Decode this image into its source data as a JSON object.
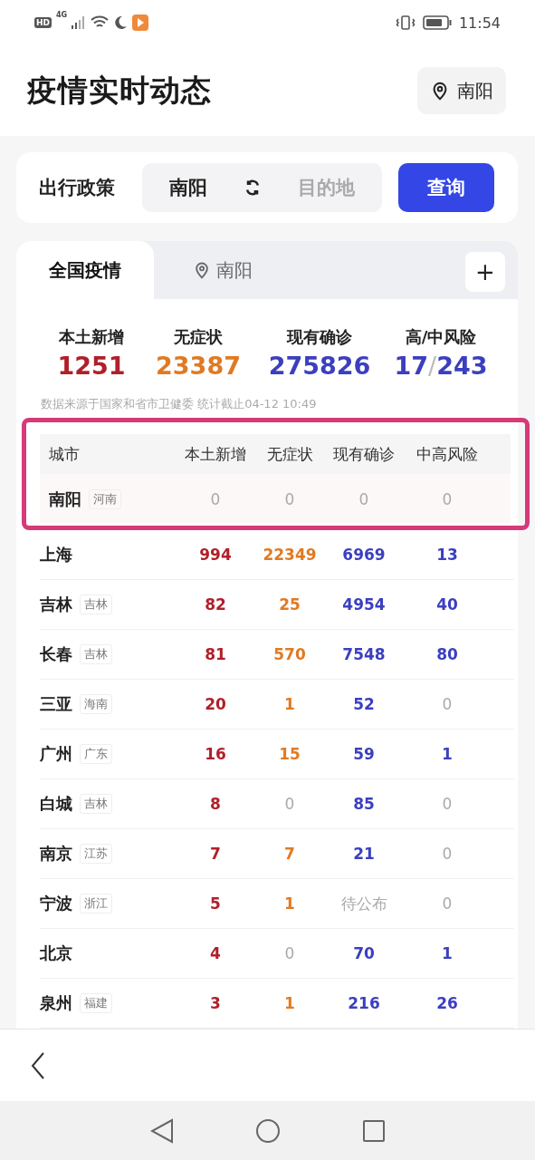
{
  "status_bar": {
    "left": "HD",
    "network": "4G",
    "time": "11:54"
  },
  "header": {
    "title": "疫情实时动态",
    "location": "南阳"
  },
  "policy": {
    "label": "出行政策",
    "from": "南阳",
    "to_placeholder": "目的地",
    "button": "查询"
  },
  "tabs": [
    {
      "label": "全国疫情",
      "selected": true,
      "kind": "plain"
    },
    {
      "label": "南阳",
      "selected": false,
      "kind": "location"
    }
  ],
  "add_button": "+",
  "stats": [
    {
      "label": "本土新增",
      "value": "1251",
      "color": "#b0202a"
    },
    {
      "label": "无症状",
      "value": "23387",
      "color": "#e07a22"
    },
    {
      "label": "现有确诊",
      "value": "275826",
      "color": "#3b3fbf"
    },
    {
      "label": "高/中风险",
      "value": "17",
      "separator": "/",
      "value2": "243",
      "color": "#3b3fbf"
    }
  ],
  "source_note": "数据来源于国家和省市卫健委 统计截止04-12 10:49",
  "table": {
    "columns": [
      "城市",
      "本土新增",
      "无症状",
      "现有确诊",
      "中高风险"
    ],
    "rows": [
      {
        "highlighted": true,
        "cells": [
          {
            "text": "南阳",
            "tag": "河南",
            "muted": false
          },
          {
            "text": "0",
            "muted": true
          },
          {
            "text": "0",
            "muted": true
          },
          {
            "text": "0",
            "muted": true
          },
          {
            "text": "0",
            "muted": true
          }
        ]
      },
      {
        "highlighted": false,
        "cells": [
          {
            "text": "上海",
            "muted": false
          },
          {
            "text": "994",
            "muted": false
          },
          {
            "text": "22349",
            "muted": false
          },
          {
            "text": "6969",
            "muted": false
          },
          {
            "text": "13",
            "muted": false
          }
        ]
      },
      {
        "highlighted": false,
        "cells": [
          {
            "text": "吉林",
            "tag": "吉林",
            "muted": false
          },
          {
            "text": "82",
            "muted": false
          },
          {
            "text": "25",
            "muted": false
          },
          {
            "text": "4954",
            "muted": false
          },
          {
            "text": "40",
            "muted": false
          }
        ]
      },
      {
        "highlighted": false,
        "cells": [
          {
            "text": "长春",
            "tag": "吉林",
            "muted": false
          },
          {
            "text": "81",
            "muted": false
          },
          {
            "text": "570",
            "muted": false
          },
          {
            "text": "7548",
            "muted": false
          },
          {
            "text": "80",
            "muted": false
          }
        ]
      },
      {
        "highlighted": false,
        "cells": [
          {
            "text": "三亚",
            "tag": "海南",
            "muted": false
          },
          {
            "text": "20",
            "muted": false
          },
          {
            "text": "1",
            "muted": false
          },
          {
            "text": "52",
            "muted": false
          },
          {
            "text": "0",
            "muted": true
          }
        ]
      },
      {
        "highlighted": false,
        "cells": [
          {
            "text": "广州",
            "tag": "广东",
            "muted": false
          },
          {
            "text": "16",
            "muted": false
          },
          {
            "text": "15",
            "muted": false
          },
          {
            "text": "59",
            "muted": false
          },
          {
            "text": "1",
            "muted": false
          }
        ]
      },
      {
        "highlighted": false,
        "cells": [
          {
            "text": "白城",
            "tag": "吉林",
            "muted": false
          },
          {
            "text": "8",
            "muted": false
          },
          {
            "text": "0",
            "muted": true
          },
          {
            "text": "85",
            "muted": false
          },
          {
            "text": "0",
            "muted": true
          }
        ]
      },
      {
        "highlighted": false,
        "cells": [
          {
            "text": "南京",
            "tag": "江苏",
            "muted": false
          },
          {
            "text": "7",
            "muted": false
          },
          {
            "text": "7",
            "muted": false
          },
          {
            "text": "21",
            "muted": false
          },
          {
            "text": "0",
            "muted": true
          }
        ]
      },
      {
        "highlighted": false,
        "cells": [
          {
            "text": "宁波",
            "tag": "浙江",
            "muted": false
          },
          {
            "text": "5",
            "muted": false
          },
          {
            "text": "1",
            "muted": false
          },
          {
            "text": "待公布",
            "muted": true
          },
          {
            "text": "0",
            "muted": true
          }
        ]
      },
      {
        "highlighted": false,
        "cells": [
          {
            "text": "北京",
            "muted": false
          },
          {
            "text": "4",
            "muted": false
          },
          {
            "text": "0",
            "muted": true
          },
          {
            "text": "70",
            "muted": false
          },
          {
            "text": "1",
            "muted": false
          }
        ]
      },
      {
        "highlighted": false,
        "cells": [
          {
            "text": "泉州",
            "tag": "福建",
            "muted": false
          },
          {
            "text": "3",
            "muted": false
          },
          {
            "text": "1",
            "muted": false
          },
          {
            "text": "216",
            "muted": false
          },
          {
            "text": "26",
            "muted": false
          }
        ]
      }
    ]
  }
}
